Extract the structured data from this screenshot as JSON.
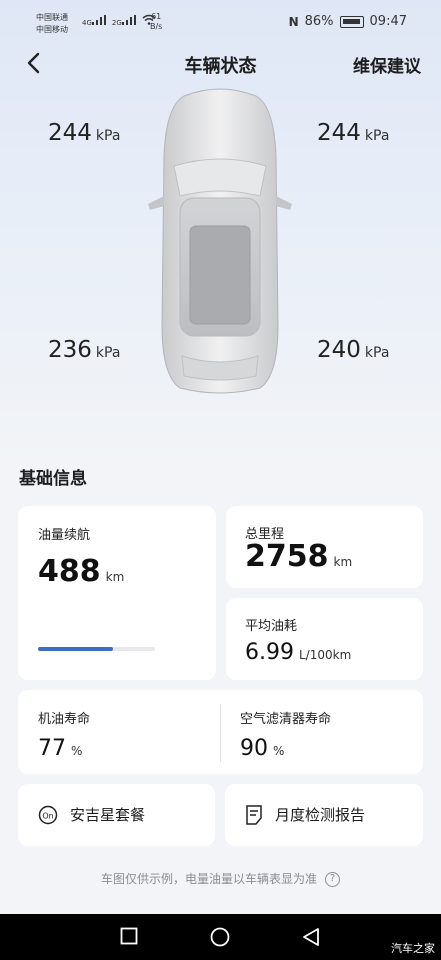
{
  "status": {
    "carrier1": "中国联通",
    "carrier2": "中国移动",
    "net1": "4G",
    "net2": "2G",
    "speed_value": "61",
    "speed_unit": "B/s",
    "battery": "86%",
    "time": "09:47"
  },
  "header": {
    "title": "车辆状态",
    "maintenance_label": "维保建议"
  },
  "tires": {
    "front_left": "244",
    "front_right": "244",
    "rear_left": "236",
    "rear_right": "240",
    "unit": "kPa"
  },
  "basic_info": {
    "title": "基础信息",
    "range_label": "油量续航",
    "range_value": "488",
    "range_unit": "km",
    "range_fill_fraction": 0.64,
    "odometer_label": "总里程",
    "odometer_value": "2758",
    "odometer_unit": "km",
    "avg_fuel_label": "平均油耗",
    "avg_fuel_value": "6.99",
    "avg_fuel_unit": "L/100km",
    "oil_life_label": "机油寿命",
    "oil_life_value": "77",
    "oil_life_unit": "%",
    "air_filter_label": "空气滤清器寿命",
    "air_filter_value": "90",
    "air_filter_unit": "%"
  },
  "services": {
    "package_label": "安吉星套餐",
    "report_label": "月度检测报告"
  },
  "disclaimer": "车图仅供示例，电量油量以车辆表显为准",
  "watermark": "汽车之家",
  "colors": {
    "accent": "#3b6fc6",
    "card": "#ffffff",
    "background": "#f2f4f7"
  }
}
